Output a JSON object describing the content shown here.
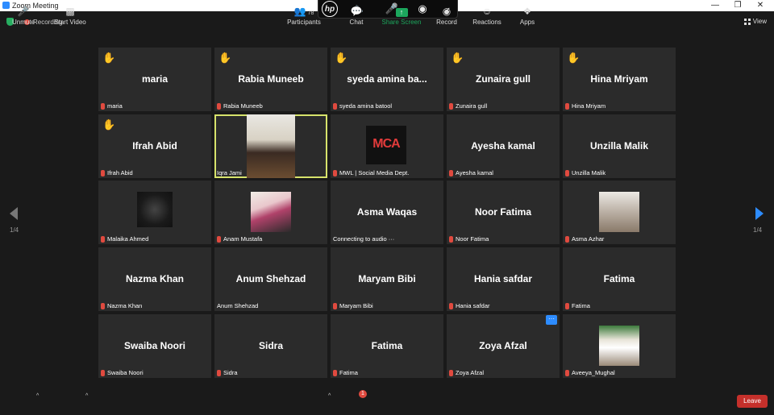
{
  "window": {
    "title": "Zoom Meeting"
  },
  "status": {
    "recording": "Recording",
    "view": "View"
  },
  "pagination": {
    "left": "1/4",
    "right": "1/4"
  },
  "tiles": [
    {
      "name": "maria",
      "label": "maria",
      "hand": true,
      "muted": true
    },
    {
      "name": "Rabia Muneeb",
      "label": "Rabia Muneeb",
      "hand": true,
      "muted": true
    },
    {
      "name": "syeda amina ba...",
      "label": "syeda amina batool",
      "hand": true,
      "muted": true
    },
    {
      "name": "Zunaira gull",
      "label": "Zunaira gull",
      "hand": true,
      "muted": true
    },
    {
      "name": "Hina Mriyam",
      "label": "Hina Mriyam",
      "hand": true,
      "muted": true
    },
    {
      "name": "Ifrah Abid",
      "label": "Ifrah Abid",
      "hand": true,
      "muted": true
    },
    {
      "name": "",
      "label": "Iqra Jami",
      "video": true,
      "active": true
    },
    {
      "name": "",
      "label": "MWL | Social Media Dept.",
      "video": true,
      "logo_text": "MCA",
      "muted": true
    },
    {
      "name": "Ayesha kamal",
      "label": "Ayesha kamal",
      "muted": true
    },
    {
      "name": "Unzilla Malik",
      "label": "Unzilla Malik",
      "muted": true
    },
    {
      "name": "",
      "label": "Malaika Ahmed",
      "video": true,
      "muted": true
    },
    {
      "name": "",
      "label": "Anam Mustafa",
      "video": true,
      "muted": true
    },
    {
      "name": "Asma Waqas",
      "label": "Connecting to audio ···"
    },
    {
      "name": "Noor Fatima",
      "label": "Noor Fatima",
      "muted": true
    },
    {
      "name": "",
      "label": "Asma Azhar",
      "video": true,
      "muted": true
    },
    {
      "name": "Nazma Khan",
      "label": "Nazma Khan",
      "muted": true
    },
    {
      "name": "Anum Shehzad",
      "label": "Anum Shehzad"
    },
    {
      "name": "Maryam Bibi",
      "label": "Maryam Bibi",
      "muted": true
    },
    {
      "name": "Hania safdar",
      "label": "Hania safdar",
      "muted": true
    },
    {
      "name": "Fatima",
      "label": "Fatima",
      "muted": true
    },
    {
      "name": "Swaiba Noori",
      "label": "Swaiba Noori",
      "muted": true
    },
    {
      "name": "Sidra",
      "label": "Sidra",
      "muted": true
    },
    {
      "name": "Fatima",
      "label": "Fatima",
      "muted": true
    },
    {
      "name": "Zoya Afzal",
      "label": "Zoya Afzal",
      "muted": true
    },
    {
      "name": "",
      "label": "Aveeya_Mughal",
      "video": true,
      "muted": true
    }
  ],
  "more_button": "···",
  "toolbar": {
    "unmute": "Unmute",
    "start_video": "Start Video",
    "participants": "Participants",
    "participants_count": "78",
    "chat": "Chat",
    "chat_badge": "1",
    "share_screen": "Share Screen",
    "record": "Record",
    "reactions": "Reactions",
    "apps": "Apps",
    "leave": "Leave"
  },
  "colors": {
    "accent": "#2d8cff",
    "share": "#1ca75d",
    "leave": "#c5302b",
    "active_border": "#d7e36b",
    "hand": "#f5c242"
  }
}
